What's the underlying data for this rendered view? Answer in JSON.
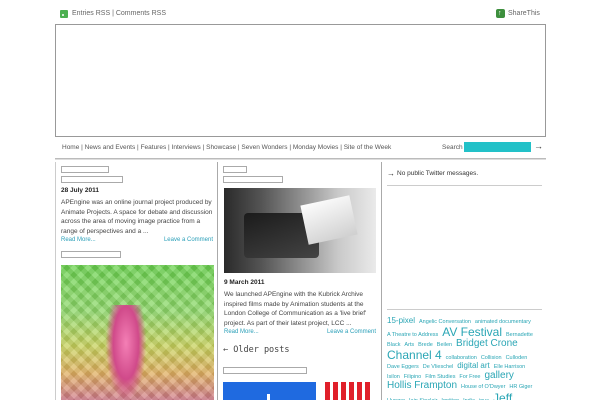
{
  "header": {
    "rss_links": "Entries RSS | Comments RSS",
    "share": "ShareThis"
  },
  "nav": {
    "items": [
      "Home",
      "News and Events",
      "Features",
      "Interviews",
      "Showcase",
      "Seven Wonders",
      "Monday Movies",
      "Site of the Week"
    ],
    "search_label": "Search",
    "search_value": ""
  },
  "posts": {
    "left": {
      "date": "28 July 2011",
      "excerpt": "APEngine was an online journal project produced by Animate Projects. A space for debate and discussion across the area of moving image practice from a range of perspectives and a ...",
      "read_more": "Read More...",
      "comment": "Leave a Comment"
    },
    "middle": {
      "date": "9 March 2011",
      "excerpt": "We launched APEngine with the Kubrick Archive inspired films made by Animation students at the London College of Communication as a 'live brief' project. As part of their latest project, LCC ...",
      "read_more": "Read More...",
      "comment": "Leave a Comment"
    },
    "older": "← Older posts"
  },
  "sidebar": {
    "twitter": "No public Twitter messages.",
    "tags": [
      {
        "text": "15-pixel",
        "size": "m"
      },
      {
        "text": "Angelic Conversation",
        "size": "s"
      },
      {
        "text": "animated documentary",
        "size": "s"
      },
      {
        "text": "A Theatre to Address",
        "size": "s"
      },
      {
        "text": "AV Festival",
        "size": "xl"
      },
      {
        "text": "Bernadette Black",
        "size": "s"
      },
      {
        "text": "Arts",
        "size": "s"
      },
      {
        "text": "Brede",
        "size": "s"
      },
      {
        "text": "Beilen",
        "size": "s"
      },
      {
        "text": "Bridget Crone",
        "size": "l"
      },
      {
        "text": "Channel 4",
        "size": "xl"
      },
      {
        "text": "collaboration",
        "size": "s"
      },
      {
        "text": "Collision",
        "size": "s"
      },
      {
        "text": "Culloden",
        "size": "s"
      },
      {
        "text": "Dave Eggers",
        "size": "s"
      },
      {
        "text": "De Vlieschel",
        "size": "s"
      },
      {
        "text": "digital art",
        "size": "m"
      },
      {
        "text": "Elle Harrison",
        "size": "s"
      },
      {
        "text": "Isilon",
        "size": "s"
      },
      {
        "text": "Filipino",
        "size": "s"
      },
      {
        "text": "Film Studies",
        "size": "s"
      },
      {
        "text": "For Free",
        "size": "s"
      },
      {
        "text": "gallery",
        "size": "l"
      },
      {
        "text": "Hollis Frampton",
        "size": "l"
      },
      {
        "text": "House of O'Dwyer",
        "size": "s"
      },
      {
        "text": "HR Giger",
        "size": "s"
      },
      {
        "text": "Hunger",
        "size": "s"
      },
      {
        "text": "Iain Sinclair",
        "size": "s"
      },
      {
        "text": "Ignition",
        "size": "s"
      },
      {
        "text": "India",
        "size": "s"
      },
      {
        "text": "inva",
        "size": "s"
      },
      {
        "text": "Jeff",
        "size": "xl"
      }
    ]
  }
}
